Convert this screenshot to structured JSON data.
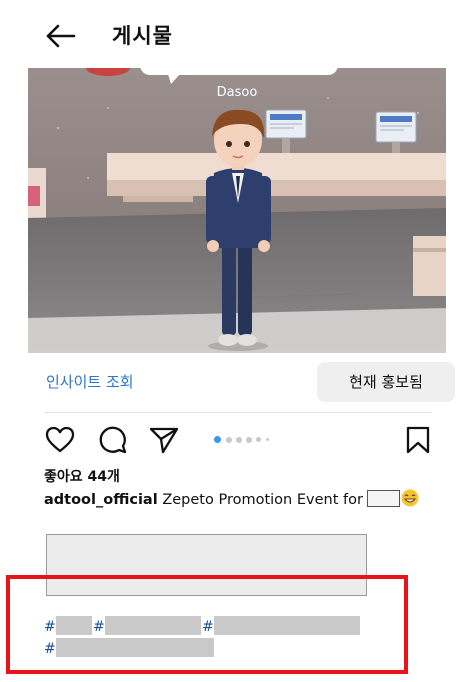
{
  "header": {
    "title": "게시물",
    "back_icon": "arrow-left-icon"
  },
  "media": {
    "avatar_name": "Dasoo"
  },
  "insight": {
    "link_label": "인사이트 조회",
    "boost_label": "현재 홍보됨"
  },
  "actions": {
    "icons": [
      "heart-icon",
      "comment-icon",
      "share-icon",
      "bookmark-icon"
    ],
    "carousel_active_index": 0,
    "carousel_dot_count": 6,
    "accent_color": "#3897f0"
  },
  "post": {
    "likes_label": "좋아요",
    "likes_count": "44개",
    "username": "adtool_official",
    "caption_text": "Zepeto Promotion Event for",
    "hashtags": [
      "#",
      "#",
      "#",
      "#"
    ]
  },
  "colors": {
    "link": "#2f74d0",
    "highlight_border": "#e8141c"
  }
}
